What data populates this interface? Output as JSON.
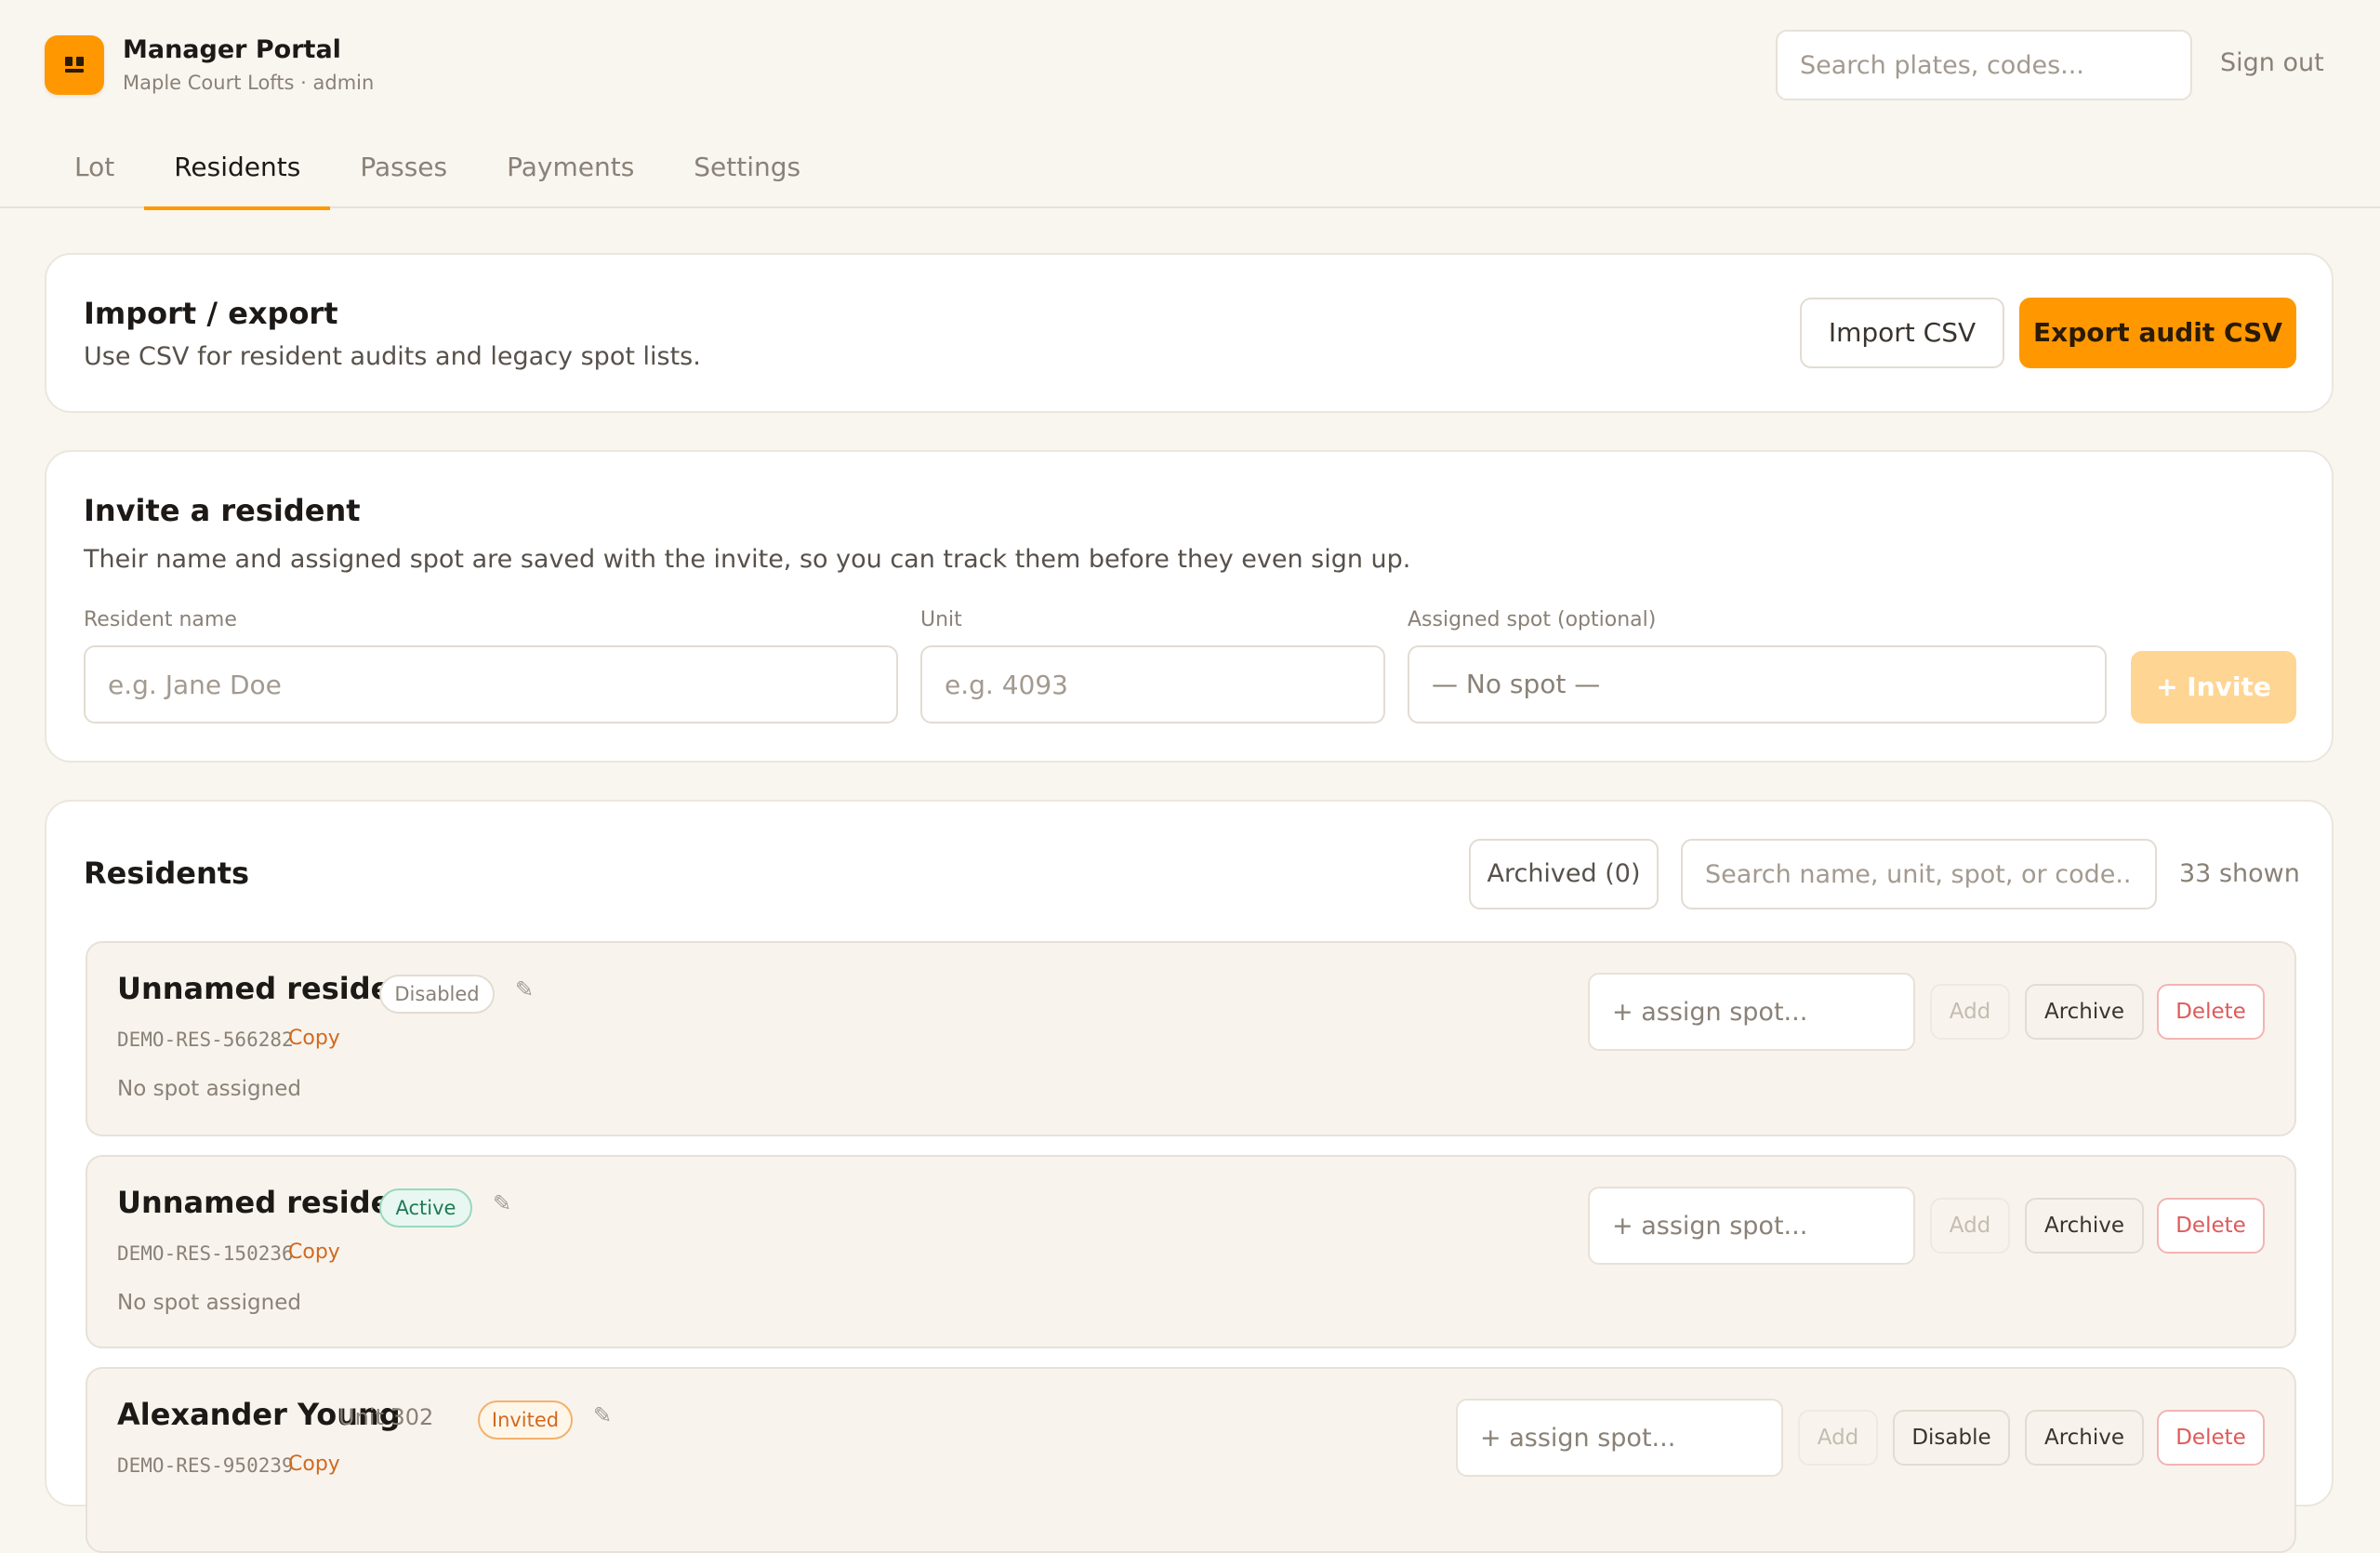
{
  "app": {
    "title": "Manager Portal",
    "subtitle": "Maple Court Lofts · admin",
    "brand_color": "#ff9800",
    "logo_icon": "parking-lot-icon"
  },
  "header": {
    "search_placeholder": "Search plates, codes...",
    "sign_out": "Sign out"
  },
  "tabs": [
    {
      "label": "Lot",
      "active": false
    },
    {
      "label": "Residents",
      "active": true
    },
    {
      "label": "Passes",
      "active": false
    },
    {
      "label": "Payments",
      "active": false
    },
    {
      "label": "Settings",
      "active": false
    }
  ],
  "import_export": {
    "title": "Import / export",
    "description": "Use CSV for resident audits and legacy spot lists.",
    "import_label": "Import CSV",
    "export_label": "Export audit CSV"
  },
  "invite": {
    "title": "Invite a resident",
    "description": "Their name and assigned spot are saved with the invite, so you can track them before they even sign up.",
    "name_label": "Resident name",
    "name_placeholder": "e.g. Jane Doe",
    "unit_label": "Unit",
    "unit_placeholder": "e.g. 4093",
    "spot_label": "Assigned spot (optional)",
    "spot_value": "— No spot —",
    "invite_label": "+ Invite"
  },
  "residents": {
    "title": "Residents",
    "archived_label": "Archived (0)",
    "search_placeholder": "Search name, unit, spot, or code...",
    "shown_count": "33 shown",
    "assign_placeholder": "+ assign spot...",
    "add_label": "Add",
    "archive_label": "Archive",
    "delete_label": "Delete",
    "disable_label": "Disable",
    "copy_label": "Copy",
    "edit_icon": "pencil-icon",
    "status_colors": {
      "active": "#1f7a56",
      "invited": "#d2691e",
      "disabled": "#8a8177"
    },
    "items": [
      {
        "name": "Unnamed resident",
        "unit": "",
        "status": "Disabled",
        "code": "DEMO-RES-566282",
        "spot": "No spot assigned"
      },
      {
        "name": "Unnamed resident",
        "unit": "",
        "status": "Active",
        "code": "DEMO-RES-150236",
        "spot": "No spot assigned"
      },
      {
        "name": "Alexander Young",
        "unit": "Unit 302",
        "status": "Invited",
        "code": "DEMO-RES-950239",
        "spot": ""
      }
    ]
  }
}
